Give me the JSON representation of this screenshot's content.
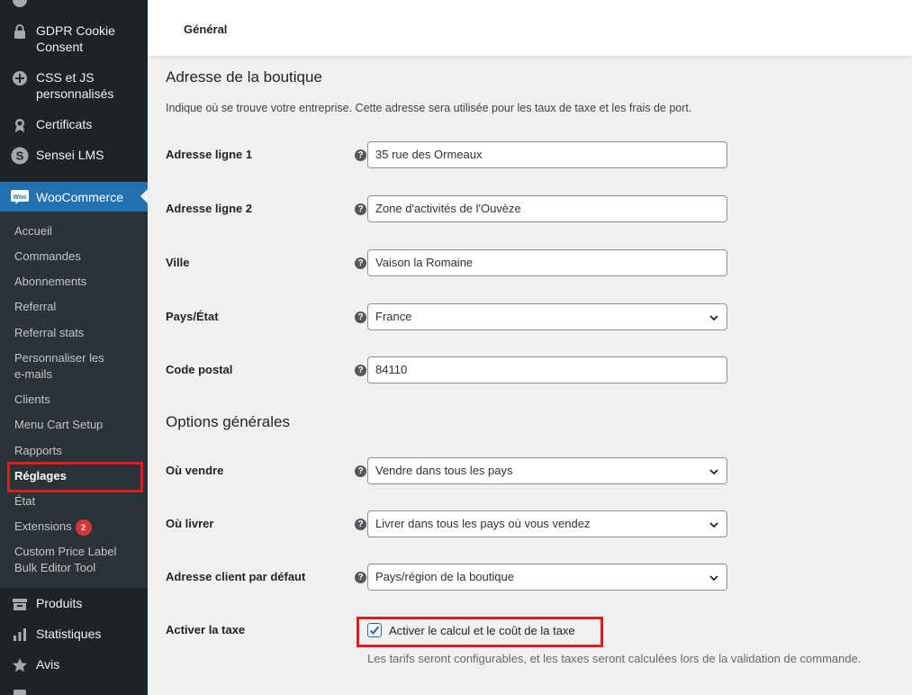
{
  "sidebar": {
    "top_items": [
      {
        "label": "GDPR Cookie Consent",
        "icon": "lock-icon"
      },
      {
        "label": "CSS et JS personnalisés",
        "icon": "plus-circle-icon"
      },
      {
        "label": "Certificats",
        "icon": "award-icon"
      },
      {
        "label": "Sensei LMS",
        "icon": "sensei-icon"
      }
    ],
    "active": {
      "label": "WooCommerce",
      "icon": "woocommerce-icon"
    },
    "submenu": [
      {
        "label": "Accueil"
      },
      {
        "label": "Commandes"
      },
      {
        "label": "Abonnements"
      },
      {
        "label": "Referral"
      },
      {
        "label": "Referral stats"
      },
      {
        "label": "Personnaliser les e-mails"
      },
      {
        "label": "Clients"
      },
      {
        "label": "Menu Cart Setup"
      },
      {
        "label": "Rapports"
      },
      {
        "label": "Réglages",
        "current": true
      },
      {
        "label": "État"
      },
      {
        "label": "Extensions",
        "badge": "2"
      },
      {
        "label": "Custom Price Label Bulk Editor Tool"
      }
    ],
    "bottom_items": [
      {
        "label": "Produits",
        "icon": "archive-icon"
      },
      {
        "label": "Statistiques",
        "icon": "bar-chart-icon"
      },
      {
        "label": "Avis",
        "icon": "star-icon"
      }
    ]
  },
  "topbar": {
    "tab": "Général"
  },
  "store_address": {
    "title": "Adresse de la boutique",
    "description": "Indique où se trouve votre entreprise. Cette adresse sera utilisée pour les taux de taxe et les frais de port.",
    "fields": [
      {
        "label": "Adresse ligne 1",
        "value": "35 rue des Ormeaux"
      },
      {
        "label": "Adresse ligne 2",
        "value": "Zone d'activités de l'Ouvèze"
      },
      {
        "label": "Ville",
        "value": "Vaison la Romaine"
      },
      {
        "label": "Pays/État",
        "value": "France"
      },
      {
        "label": "Code postal",
        "value": "84110"
      }
    ]
  },
  "general_options": {
    "title": "Options générales",
    "fields": [
      {
        "label": "Où vendre",
        "value": "Vendre dans tous les pays"
      },
      {
        "label": "Où livrer",
        "value": "Livrer dans tous les pays où vous vendez"
      },
      {
        "label": "Adresse client par défaut",
        "value": "Pays/région de la boutique"
      }
    ],
    "tax": {
      "label": "Activer la taxe",
      "checkbox_label": "Activer le calcul et le coût de la taxe",
      "checked": true,
      "description": "Les tarifs seront configurables, et les taxes seront calculées lors de la validation de commande."
    }
  },
  "colors": {
    "sidebar": "#1d2327",
    "submenu": "#2c3338",
    "accent": "#2271b1",
    "highlight": "#e11b22"
  }
}
